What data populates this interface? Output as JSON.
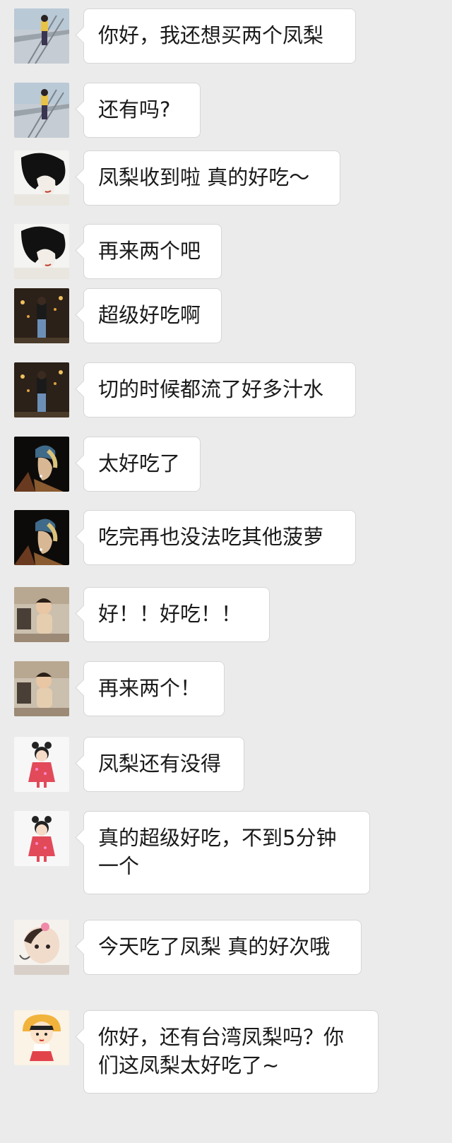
{
  "messages": [
    {
      "text": "你好，我还想买两个凤梨",
      "avatar": "sea-railing-photo-avatar"
    },
    {
      "text": "还有吗?",
      "avatar": "sea-railing-photo-avatar"
    },
    {
      "text": "凤梨收到啦 真的好吃～",
      "avatar": "illustrated-face-avatar"
    },
    {
      "text": "再来两个吧",
      "avatar": "illustrated-face-avatar"
    },
    {
      "text": "超级好吃啊",
      "avatar": "night-street-photo-avatar"
    },
    {
      "text": "切的时候都流了好多汁水",
      "avatar": "night-street-photo-avatar"
    },
    {
      "text": "太好吃了",
      "avatar": "pearl-earring-painting-avatar"
    },
    {
      "text": "吃完再也没法吃其他菠萝",
      "avatar": "pearl-earring-painting-avatar"
    },
    {
      "text": "好！！好吃！！",
      "avatar": "toddler-photo-avatar"
    },
    {
      "text": "再来两个！",
      "avatar": "toddler-photo-avatar"
    },
    {
      "text": "凤梨还有没得",
      "avatar": "cartoon-girl-avatar"
    },
    {
      "text": "真的超级好吃，不到5分钟一个",
      "avatar": "cartoon-girl-avatar"
    },
    {
      "text": "今天吃了凤梨 真的好次哦",
      "avatar": "baby-sketch-avatar"
    },
    {
      "text": "你好，还有台湾凤梨吗？你们这凤梨太好吃了~",
      "avatar": "chibi-maruko-avatar"
    }
  ],
  "colors": {
    "background": "#ebebeb",
    "bubble": "#ffffff",
    "bubble_border": "#d6d6d6",
    "text": "#1a1a1a"
  }
}
